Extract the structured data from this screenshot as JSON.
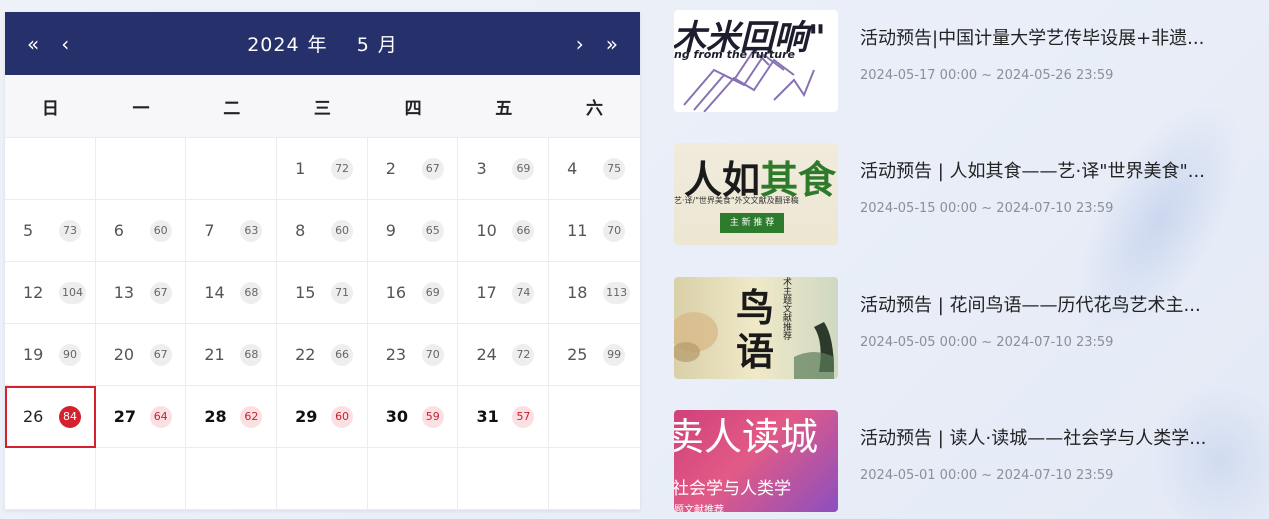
{
  "calendar": {
    "prev_year_icon": "«",
    "prev_month_icon": "‹",
    "next_month_icon": "›",
    "next_year_icon": "»",
    "year": "2024",
    "year_suffix": "年",
    "month": "5",
    "month_suffix": "月",
    "weekdays": [
      "日",
      "一",
      "二",
      "三",
      "四",
      "五",
      "六"
    ],
    "cells": [
      {
        "day": "",
        "count": ""
      },
      {
        "day": "",
        "count": ""
      },
      {
        "day": "",
        "count": ""
      },
      {
        "day": "1",
        "count": "72"
      },
      {
        "day": "2",
        "count": "67"
      },
      {
        "day": "3",
        "count": "69"
      },
      {
        "day": "4",
        "count": "75"
      },
      {
        "day": "5",
        "count": "73"
      },
      {
        "day": "6",
        "count": "60"
      },
      {
        "day": "7",
        "count": "63"
      },
      {
        "day": "8",
        "count": "60"
      },
      {
        "day": "9",
        "count": "65"
      },
      {
        "day": "10",
        "count": "66"
      },
      {
        "day": "11",
        "count": "70"
      },
      {
        "day": "12",
        "count": "104"
      },
      {
        "day": "13",
        "count": "67"
      },
      {
        "day": "14",
        "count": "68"
      },
      {
        "day": "15",
        "count": "71"
      },
      {
        "day": "16",
        "count": "69"
      },
      {
        "day": "17",
        "count": "74"
      },
      {
        "day": "18",
        "count": "113"
      },
      {
        "day": "19",
        "count": "90"
      },
      {
        "day": "20",
        "count": "67"
      },
      {
        "day": "21",
        "count": "68"
      },
      {
        "day": "22",
        "count": "66"
      },
      {
        "day": "23",
        "count": "70"
      },
      {
        "day": "24",
        "count": "72"
      },
      {
        "day": "25",
        "count": "99"
      },
      {
        "day": "26",
        "count": "84"
      },
      {
        "day": "27",
        "count": "64"
      },
      {
        "day": "28",
        "count": "62"
      },
      {
        "day": "29",
        "count": "60"
      },
      {
        "day": "30",
        "count": "59"
      },
      {
        "day": "31",
        "count": "57"
      },
      {
        "day": "",
        "count": ""
      },
      {
        "day": "",
        "count": ""
      },
      {
        "day": "",
        "count": ""
      },
      {
        "day": "",
        "count": ""
      },
      {
        "day": "",
        "count": ""
      },
      {
        "day": "",
        "count": ""
      },
      {
        "day": "",
        "count": ""
      },
      {
        "day": "",
        "count": ""
      }
    ],
    "today": "26"
  },
  "events": [
    {
      "title": "活动预告|中国计量大学艺传毕设展+非遗...",
      "date": "2024-05-17 00:00 ~ 2024-05-26 23:59",
      "thumb_text_main": "木米回响\"",
      "thumb_text_sub": "ng from the furture"
    },
    {
      "title": "活动预告 | 人如其食——艺·译\"世界美食\"...",
      "date": "2024-05-15 00:00 ~ 2024-07-10 23:59",
      "thumb_text_main_a": "人如",
      "thumb_text_main_b": "其食",
      "thumb_text_sub": "艺·译/\"世界美食\"外文文献及翻译稿",
      "thumb_text_btn": "主 新 推 荐"
    },
    {
      "title": "活动预告 | 花间鸟语——历代花鸟艺术主...",
      "date": "2024-05-05 00:00 ~ 2024-07-10 23:59",
      "thumb_text_main_a": "鸟",
      "thumb_text_main_b": "语",
      "thumb_text_side": "术主题文献推荐"
    },
    {
      "title": "活动预告 | 读人·读城——社会学与人类学...",
      "date": "2024-05-01 00:00 ~ 2024-07-10 23:59",
      "thumb_text_main": "卖人读城",
      "thumb_text_sub": "社会学与人类学",
      "thumb_text_foot": "题文献推荐"
    }
  ]
}
